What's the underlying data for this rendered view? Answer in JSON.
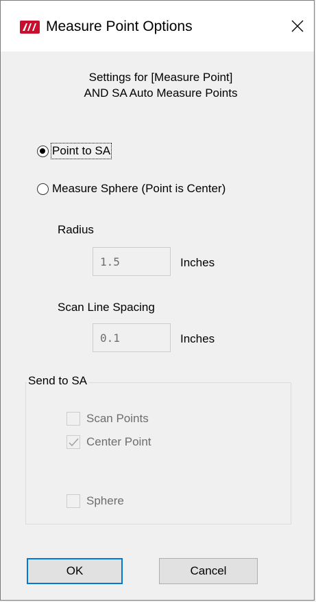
{
  "titlebar": {
    "title": "Measure Point Options",
    "app_logo_icon": "api-logo-icon",
    "close_icon": "close-icon",
    "logo_color": "#c8102e"
  },
  "header": {
    "line1": "Settings for [Measure Point]",
    "line2": "AND SA Auto Measure Points"
  },
  "mode": {
    "selected": "point_to_sa",
    "options": [
      {
        "id": "point_to_sa",
        "label": "Point to SA",
        "checked": true
      },
      {
        "id": "measure_sphere",
        "label": "Measure Sphere (Point is Center)",
        "checked": false
      }
    ]
  },
  "radius": {
    "label": "Radius",
    "value": "1.5",
    "unit": "Inches"
  },
  "scan_line": {
    "label": "Scan Line Spacing",
    "value": "0.1",
    "unit": "Inches"
  },
  "send_group": {
    "title": "Send to SA",
    "items": [
      {
        "label": "Scan Points",
        "checked": false,
        "enabled": false
      },
      {
        "label": "Center Point",
        "checked": true,
        "enabled": false
      },
      {
        "label": "Sphere",
        "checked": false,
        "enabled": false
      }
    ]
  },
  "buttons": {
    "ok": "OK",
    "cancel": "Cancel"
  },
  "colors": {
    "dialog_bg": "#f0f0f0",
    "titlebar_bg": "#ffffff",
    "default_button_border": "#0078d7",
    "disabled_text": "#6d6d6d"
  }
}
